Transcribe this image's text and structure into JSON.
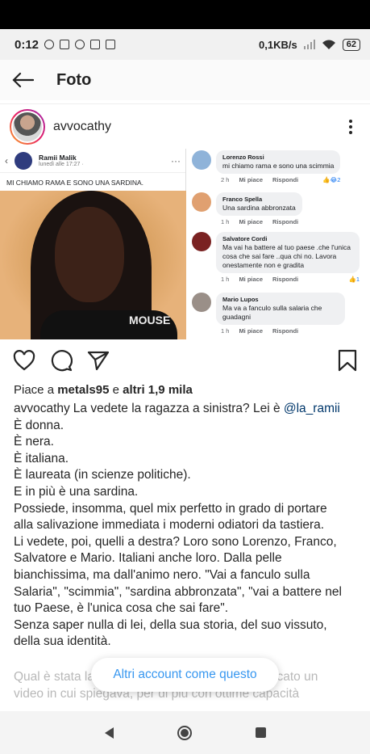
{
  "status_bar": {
    "time": "0:12",
    "network_speed": "0,1KB/s",
    "battery": "62"
  },
  "header": {
    "title": "Foto"
  },
  "post": {
    "username": "avvocathy",
    "likes_prefix": "Piace a",
    "likes_user": "metals95",
    "likes_mid": "e",
    "likes_others": "altri 1,9 mila",
    "caption_user": "avvocathy",
    "caption_lines": [
      "La vedete la ragazza a sinistra? Lei è ",
      "È donna.",
      "È nera.",
      "È italiana.",
      "È laureata (in scienze politiche).",
      "E in più è una sardina.",
      "Possiede, insomma, quel mix perfetto in grado di portare",
      "alla salivazione immediata i moderni odiatori da tastiera.",
      "Li vedete, poi, quelli a destra? Loro sono Lorenzo, Franco,",
      "Salvatore e Mario. Italiani anche loro. Dalla pelle",
      "bianchissima, ma dall'animo nero. \"Vai a fanculo sulla",
      "Salaria\", \"scimmia\", \"sardina abbronzata\", \"vai a battere nel",
      "tuo Paese, è l'unica cosa che sai fare\".",
      "Senza saper nulla di lei, della sua storia, del suo vissuto,",
      "della sua identità."
    ],
    "mention": "@la_ramii",
    "faded_line_1": "Qual è stata la                                           pubblicato un",
    "faded_line_2": "video in cui spiegava, per di più con ottime capacità"
  },
  "embedded_image": {
    "fb_name": "Ramii Malik",
    "fb_date": "lunedì alle 17:27 · ",
    "fb_caption": "MI CHIAMO RAMA E SONO UNA SARDINA.",
    "shirt_text": "MOUSE",
    "comments": [
      {
        "name": "Lorenzo Rossi",
        "text": "mi chiamo rama e sono una scimmia",
        "time": "2 h",
        "like": "Mi piace",
        "reply": "Rispondi",
        "reactions": "2"
      },
      {
        "name": "Franco Spella",
        "text": "Una sardina abbronzata",
        "time": "1 h",
        "like": "Mi piace",
        "reply": "Rispondi",
        "reactions": ""
      },
      {
        "name": "Salvatore Cordi",
        "text": "Ma vai ha battere al tuo paese .che l'unica cosa che sai fare ..qua chi no. Lavora onestamente non e gradita",
        "time": "1 h",
        "like": "Mi piace",
        "reply": "Rispondi",
        "reactions": "1"
      },
      {
        "name": "Mario Lupos",
        "text": "Ma va a fanculo sulla  salaria che guadagni",
        "time": "1 h",
        "like": "Mi piace",
        "reply": "Rispondi",
        "reactions": ""
      }
    ]
  },
  "toast": {
    "label": "Altri account come questo"
  },
  "colors": {
    "link_blue": "#3797f0",
    "mention_blue": "#00376b",
    "text": "#262626"
  }
}
